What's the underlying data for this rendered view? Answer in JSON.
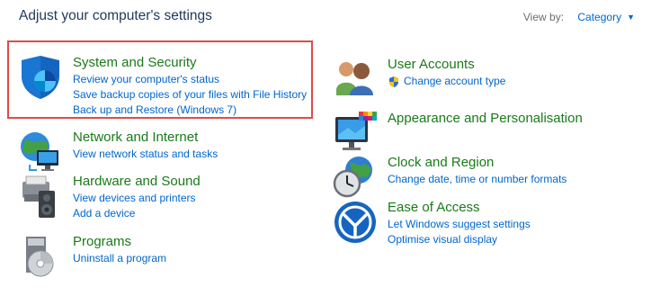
{
  "header": {
    "title": "Adjust your computer's settings",
    "view_by_label": "View by:",
    "view_by_value": "Category"
  },
  "categories_left": [
    {
      "title": "System and Security",
      "icon": "shield-icon",
      "links": [
        "Review your computer's status",
        "Save backup copies of your files with File History",
        "Back up and Restore (Windows 7)"
      ]
    },
    {
      "title": "Network and Internet",
      "icon": "network-globe-icon",
      "links": [
        "View network status and tasks"
      ]
    },
    {
      "title": "Hardware and Sound",
      "icon": "printer-speaker-icon",
      "links": [
        "View devices and printers",
        "Add a device"
      ]
    },
    {
      "title": "Programs",
      "icon": "programs-disc-icon",
      "links": [
        "Uninstall a program"
      ]
    }
  ],
  "categories_right": [
    {
      "title": "User Accounts",
      "icon": "users-icon",
      "links": [
        "Change account type"
      ],
      "link_icon": "uac-shield-icon"
    },
    {
      "title": "Appearance and Personalisation",
      "icon": "monitor-palette-icon",
      "links": []
    },
    {
      "title": "Clock and Region",
      "icon": "clock-globe-icon",
      "links": [
        "Change date, time or number formats"
      ]
    },
    {
      "title": "Ease of Access",
      "icon": "ease-of-access-icon",
      "links": [
        "Let Windows suggest settings",
        "Optimise visual display"
      ]
    }
  ],
  "colors": {
    "title_green": "#1a7a1a",
    "link_blue": "#0066cc",
    "highlight_red": "#e04a4a"
  }
}
